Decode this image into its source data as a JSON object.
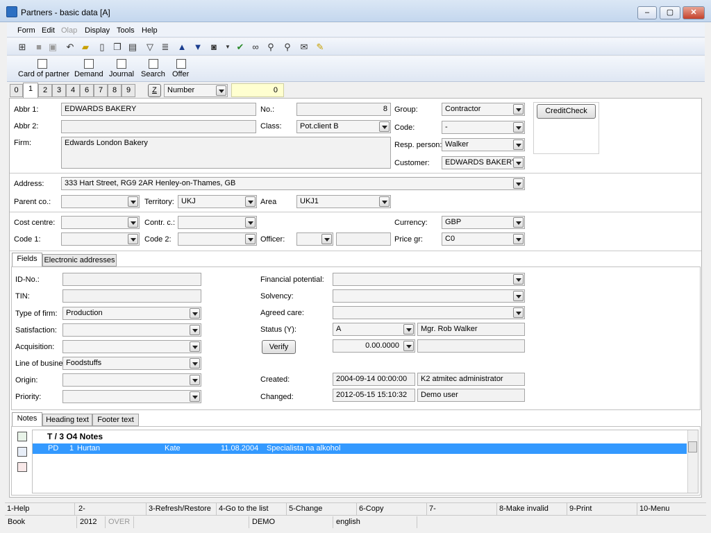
{
  "window": {
    "title": "Partners - basic data [A]",
    "min": "–",
    "max": "▢",
    "close": "✕"
  },
  "menu": [
    "Form",
    "Edit",
    "Olap",
    "Display",
    "Tools",
    "Help"
  ],
  "toolbar2": [
    "Card of partner",
    "Demand",
    "Journal",
    "Search",
    "Offer"
  ],
  "tabs": [
    "0",
    "1",
    "2",
    "3",
    "4",
    "6",
    "7",
    "8",
    "9"
  ],
  "sort": {
    "z": "Z",
    "field": "Number",
    "value": "0"
  },
  "header": {
    "abbr1_label": "Abbr 1:",
    "abbr1": "EDWARDS BAKERY",
    "abbr2_label": "Abbr 2:",
    "abbr2": "",
    "firm_label": "Firm:",
    "firm": "Edwards London Bakery",
    "no_label": "No.:",
    "no": "8",
    "class_label": "Class:",
    "class": "Pot.client B",
    "group_label": "Group:",
    "group": "Contractor",
    "code_label": "Code:",
    "code": "-",
    "resp_label": "Resp. person:",
    "resp": "Walker",
    "customer_label": "Customer:",
    "customer": "EDWARDS BAKERY",
    "creditcheck": "CreditCheck"
  },
  "address": {
    "address_label": "Address:",
    "address": "333  Hart Street, RG9 2AR  Henley-on-Thames, GB",
    "parent_label": "Parent co.:",
    "parent": "",
    "territory_label": "Territory:",
    "territory": "UKJ",
    "area_label": "Area",
    "area": "UKJ1"
  },
  "cost": {
    "cost_label": "Cost centre:",
    "contr_label": "Contr. c.:",
    "currency_label": "Currency:",
    "currency": "GBP",
    "code1_label": "Code 1:",
    "code2_label": "Code 2:",
    "officer_label": "Officer:",
    "price_label": "Price gr:",
    "price": "C0"
  },
  "fields_tabs": [
    "Fields",
    "Electronic addresses"
  ],
  "fields": {
    "id_label": "ID-No.:",
    "tin_label": "TIN:",
    "type_label": "Type of firm:",
    "type": "Production",
    "satisfaction_label": "Satisfaction:",
    "acquisition_label": "Acquisition:",
    "line_label": "Line of business:",
    "line": "Foodstuffs",
    "origin_label": "Origin:",
    "priority_label": "Priority:",
    "fin_label": "Financial potential:",
    "solvency_label": "Solvency:",
    "care_label": "Agreed care:",
    "status_label": "Status (Y):",
    "status": "A",
    "status_person": "Mgr. Rob Walker",
    "verify": "Verify",
    "verify_value": "0.00.0000",
    "created_label": "Created:",
    "created": "2004-09-14 00:00:00",
    "created_by": "K2 atmitec administrator",
    "changed_label": "Changed:",
    "changed": "2012-05-15 15:10:32",
    "changed_by": "Demo user"
  },
  "notes_tabs": [
    "Notes",
    "Heading text",
    "Footer text"
  ],
  "notes_table": {
    "header": "T / 3  O4  Notes",
    "row": {
      "type": "PD",
      "num": "1",
      "name": "Hurtan",
      "user": "Kate",
      "date": "11.08.2004",
      "text": "Specialista na alkohol"
    }
  },
  "fkeys": [
    "1-Help",
    "2-",
    "3-Refresh/Restore",
    "4-Go to the list",
    "5-Change",
    "6-Copy",
    "7-",
    "8-Make invalid",
    "9-Print",
    "10-Menu"
  ],
  "status": [
    "Book",
    "2012",
    "OVER",
    "",
    "DEMO",
    "english"
  ]
}
